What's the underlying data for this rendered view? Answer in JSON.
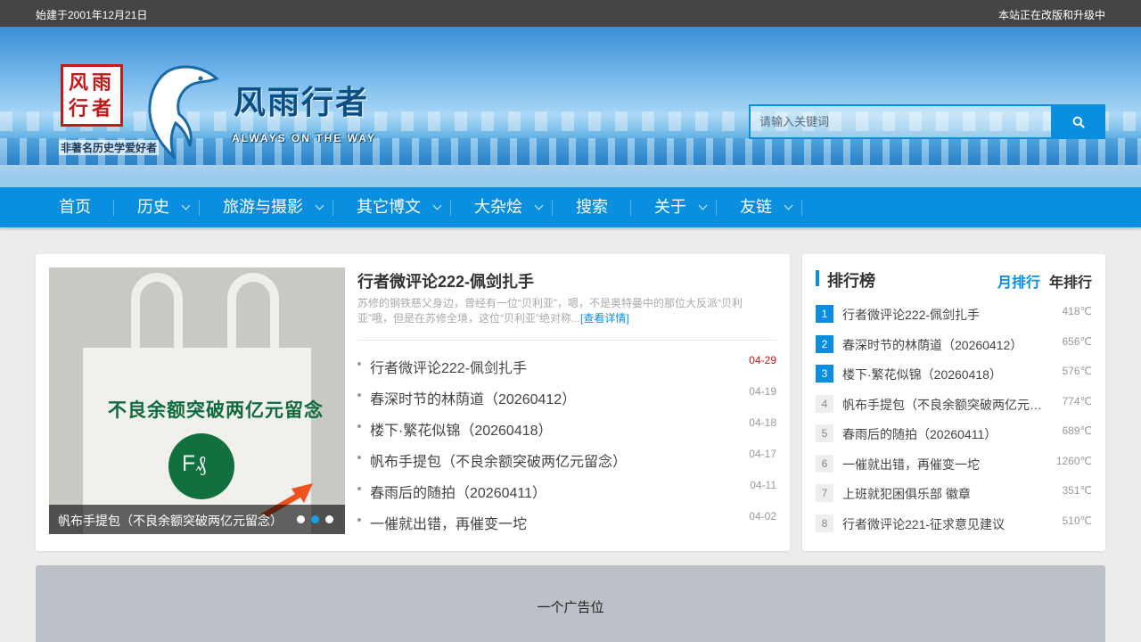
{
  "topbar": {
    "left_text": "始建于2001年12月21日",
    "right_text": "本站正在改版和升级中"
  },
  "header": {
    "seal_chars": "风雨行者",
    "seal_caption": "非著名历史学爱好者",
    "site_name": "风雨行者",
    "slogan": "ALWAYS ON THE WAY",
    "logo_icon": "dolphin-icon"
  },
  "search": {
    "placeholder": "请输入关键词",
    "button_icon": "search-icon"
  },
  "nav": {
    "items": [
      {
        "label": "首页",
        "has_submenu": false
      },
      {
        "label": "历史",
        "has_submenu": true
      },
      {
        "label": "旅游与摄影",
        "has_submenu": true
      },
      {
        "label": "其它博文",
        "has_submenu": true
      },
      {
        "label": "大杂烩",
        "has_submenu": true
      },
      {
        "label": "搜索",
        "has_submenu": false
      },
      {
        "label": "关于",
        "has_submenu": true
      },
      {
        "label": "友链",
        "has_submenu": true
      }
    ]
  },
  "slider": {
    "caption": "帆布手提包（不良余额突破两亿元留念）",
    "image_text": "不良余额突破两亿元留念",
    "slide_count": 3,
    "active_slide": 2
  },
  "feature": {
    "title": "行者微评论222-佩剑扎手",
    "summary": "苏修的钢铁慈父身边，曾经有一位“贝利亚”，嗯，不是奥特曼中的那位大反派“贝利亚”哦，但是在苏修全境，这位“贝利亚”绝对称...",
    "more_label": "[查看详情]"
  },
  "posts": [
    {
      "title": "行者微评论222-佩剑扎手",
      "date": "04-29",
      "hot": true
    },
    {
      "title": "春深时节的林荫道（20260412）",
      "date": "04-19",
      "hot": false
    },
    {
      "title": "楼下·繁花似锦（20260418）",
      "date": "04-18",
      "hot": false
    },
    {
      "title": "帆布手提包（不良余额突破两亿元留念）",
      "date": "04-17",
      "hot": false
    },
    {
      "title": "春雨后的随拍（20260411）",
      "date": "04-11",
      "hot": false
    },
    {
      "title": "一催就出错，再催变一坨",
      "date": "04-02",
      "hot": false
    }
  ],
  "ranking": {
    "title": "排行榜",
    "tab_month": "月排行",
    "tab_year": "年排行",
    "items": [
      {
        "rank": "1",
        "title": "行者微评论222-佩剑扎手",
        "temp": "418℃"
      },
      {
        "rank": "2",
        "title": "春深时节的林荫道（20260412）",
        "temp": "656℃"
      },
      {
        "rank": "3",
        "title": "楼下·繁花似锦（20260418）",
        "temp": "576℃"
      },
      {
        "rank": "4",
        "title": "帆布手提包（不良余额突破两亿元留念）",
        "temp": "774℃"
      },
      {
        "rank": "5",
        "title": "春雨后的随拍（20260411）",
        "temp": "689℃"
      },
      {
        "rank": "6",
        "title": "一催就出错，再催变一坨",
        "temp": "1260℃"
      },
      {
        "rank": "7",
        "title": "上班就犯困俱乐部 徽章",
        "temp": "351℃"
      },
      {
        "rank": "8",
        "title": "行者微评论221-征求意见建议",
        "temp": "510℃"
      }
    ]
  },
  "ad": {
    "label": "一个广告位"
  },
  "colors": {
    "accent": "#0a8fe0",
    "topbar": "#444444",
    "hot_date": "#c91414"
  }
}
